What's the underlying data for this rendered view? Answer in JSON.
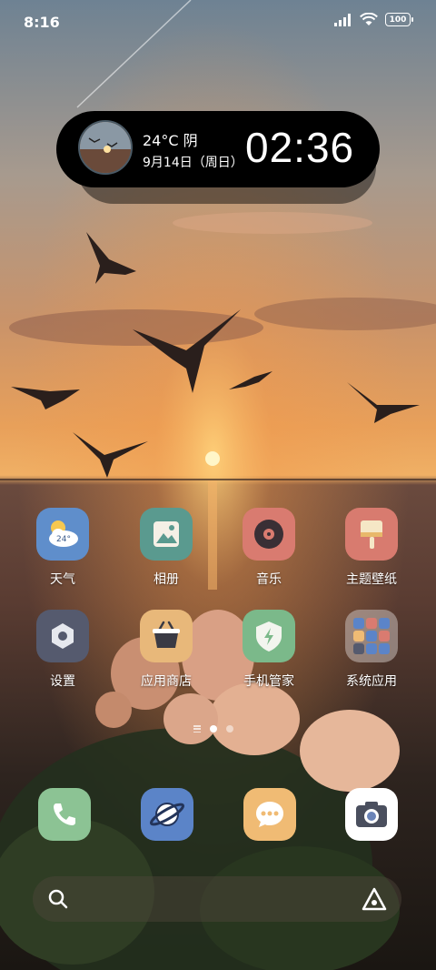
{
  "status": {
    "time": "8:16",
    "battery": "100"
  },
  "widget": {
    "weather": "24°C 阴",
    "date": "9月14日（周日）",
    "clock": "02:36"
  },
  "apps": [
    {
      "label": "天气",
      "badge": "24°"
    },
    {
      "label": "相册"
    },
    {
      "label": "音乐"
    },
    {
      "label": "主题壁纸"
    },
    {
      "label": "设置"
    },
    {
      "label": "应用商店"
    },
    {
      "label": "手机管家"
    },
    {
      "label": "系统应用"
    }
  ],
  "dock": [
    {
      "name": "phone-icon"
    },
    {
      "name": "browser-icon"
    },
    {
      "name": "messages-icon"
    },
    {
      "name": "camera-icon"
    }
  ],
  "colors": {
    "weather": "#5f8ecb",
    "gallery": "#5a9a8f",
    "music": "#d97b70",
    "themes": "#d87b6f",
    "settings": "#555a6e",
    "store": "#e8b87a",
    "security": "#7bb98a",
    "phone": "#8cc394",
    "browser": "#5b84c8",
    "messages": "#f0bb74"
  }
}
